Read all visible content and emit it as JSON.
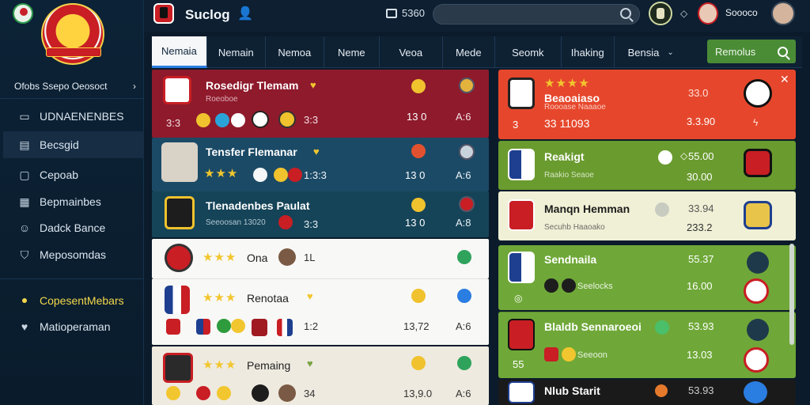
{
  "app": {
    "title": "Suclog",
    "stat": "5360",
    "user_name": "Soooco",
    "search_placeholder": ""
  },
  "sidebar": {
    "header": "Ofobs Ssepo Oeosoct",
    "header_chevron": "›",
    "items": [
      {
        "label": "UDNAENENBES",
        "icon": "monitor-icon"
      },
      {
        "label": "Becsgid",
        "icon": "folder-icon",
        "active": true
      },
      {
        "label": "Cepoab",
        "icon": "square-icon"
      },
      {
        "label": "Bepmainbes",
        "icon": "grid-icon"
      },
      {
        "label": "Dadck Bance",
        "icon": "person-icon"
      },
      {
        "label": "Meposomdas",
        "icon": "shield-icon"
      },
      {
        "label": "CopesentMebars",
        "icon": "dot-icon",
        "highlight": true
      },
      {
        "label": "Matioperaman",
        "icon": "heart-icon"
      }
    ]
  },
  "tabs": [
    {
      "label": "Nemaia",
      "active": true
    },
    {
      "label": "Nemain"
    },
    {
      "label": "Nemoa"
    },
    {
      "label": "Neme"
    },
    {
      "label": "Veoa"
    },
    {
      "label": "Mede"
    },
    {
      "label": "Seomk"
    },
    {
      "label": "Ihaking"
    },
    {
      "label": "Bensia",
      "dropdown": true
    }
  ],
  "tab_action": {
    "label": "Remolus"
  },
  "list": [
    {
      "title": "Rosedigr Tlemam",
      "sub": "Roeoboe",
      "left": "3:3",
      "mid": "3:3",
      "num": "13 0",
      "end": "A:6"
    },
    {
      "title": "Tensfer Flemanar",
      "left": "1:3:3",
      "num": "13 0",
      "end": "A:6"
    },
    {
      "title": "Tlenadenbes Paulat",
      "sub": "Seeoosan 13020",
      "badge": "3:3",
      "num": "13 0",
      "end": "A:8"
    },
    {
      "title": "Ona",
      "mid": "1L"
    },
    {
      "title": "Renotaa",
      "num": "1:2",
      "val": "13,72",
      "end": "A:6"
    },
    {
      "title": "Pemaing",
      "num": "34",
      "val": "13,9.0",
      "end": "A:6"
    }
  ],
  "right": [
    {
      "title": "Beaoaiaso",
      "sub": "Roooase Naaaoe",
      "num1": "33 11093",
      "left": "3",
      "val1": "33.0",
      "val2": "3.3.90"
    },
    {
      "title": "Reakigt",
      "sub": "Raakio Seaoe",
      "val1": "55.00",
      "val2": "30.00"
    },
    {
      "title": "Manqn Hemman",
      "sub": "Secuhb Haaoako",
      "val1": "33.94",
      "val2": "233.2"
    },
    {
      "title": "Sendnaila",
      "sub": "Seelocks",
      "val1": "55.37",
      "val2": "16.00"
    },
    {
      "title": "Blaldb Sennaroeoi",
      "sub": "Seeoon",
      "left": "55",
      "val1": "53.93",
      "val2": "13.03"
    },
    {
      "title": "Nlub Starit",
      "val1": "53.93"
    }
  ],
  "colors": {
    "row1": "#8e1a2c",
    "row2": "#1b4a66",
    "row3": "#154458",
    "light": "#f4f2ea",
    "right_red": "#e6472c",
    "right_green": "#6a9b2f",
    "right_cream": "#f0f0d6",
    "accent_yellow": "#f3d74b"
  }
}
